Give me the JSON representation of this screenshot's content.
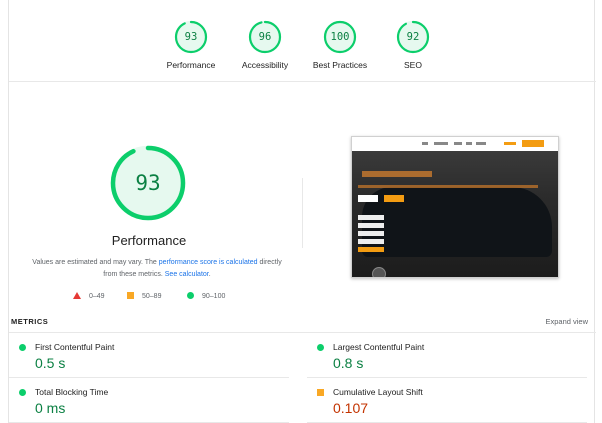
{
  "categories": [
    {
      "label": "Performance",
      "score": "93",
      "fraction": 0.93
    },
    {
      "label": "Accessibility",
      "score": "96",
      "fraction": 0.96
    },
    {
      "label": "Best Practices",
      "score": "100",
      "fraction": 1.0
    },
    {
      "label": "SEO",
      "score": "92",
      "fraction": 0.92
    }
  ],
  "main": {
    "score": "93",
    "fraction": 0.93,
    "title": "Performance",
    "note_part1": "Values are estimated and may vary. The ",
    "note_link1": "performance score is calculated",
    "note_part2": " directly from these metrics. ",
    "note_link2": "See calculator",
    "note_part3": "."
  },
  "legend": {
    "fail": "0–49",
    "average": "50–89",
    "pass": "90–100"
  },
  "metrics": {
    "title": "METRICS",
    "expand_label": "Expand view",
    "items": [
      {
        "name": "First Contentful Paint",
        "value": "0.5 s",
        "status": "good"
      },
      {
        "name": "Largest Contentful Paint",
        "value": "0.8 s",
        "status": "good"
      },
      {
        "name": "Total Blocking Time",
        "value": "0 ms",
        "status": "good"
      },
      {
        "name": "Cumulative Layout Shift",
        "value": "0.107",
        "status": "average"
      }
    ]
  },
  "colors": {
    "pass": "#0cce6b",
    "pass_text": "#0b8043",
    "average": "#f9a825",
    "average_text": "#c33300",
    "fail": "#e53935",
    "link": "#1a73e8"
  }
}
